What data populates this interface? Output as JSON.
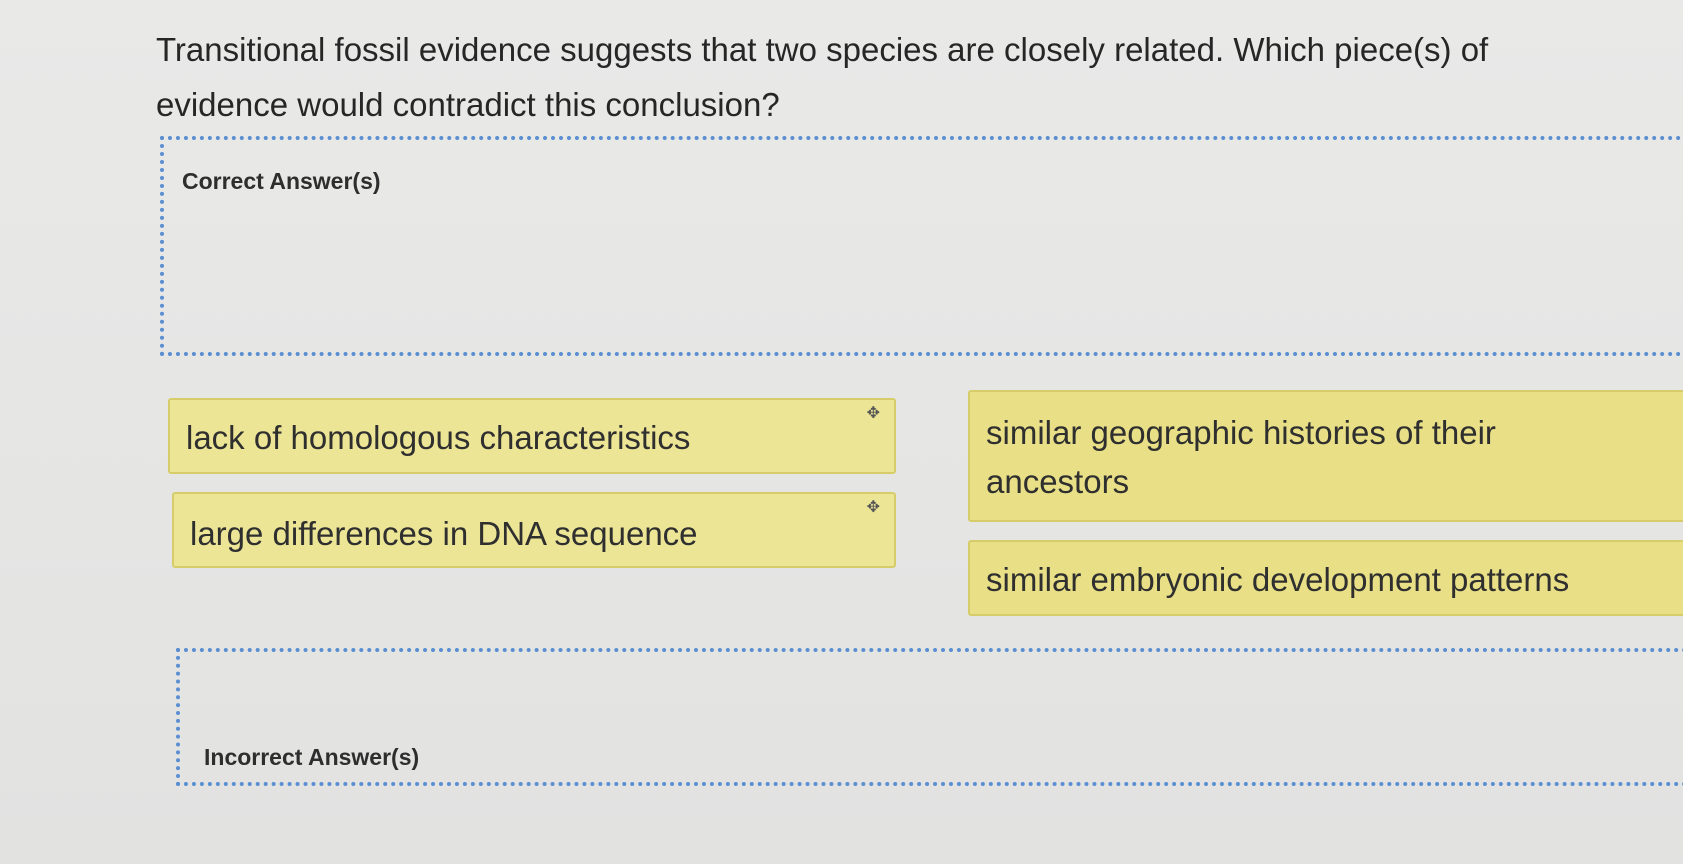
{
  "question": {
    "text": "Transitional fossil evidence suggests that two species are closely related. Which piece(s) of evidence would contradict this conclusion?"
  },
  "dropzones": {
    "correct_label": "Correct Answer(s)",
    "incorrect_label": "Incorrect Answer(s)"
  },
  "options": [
    {
      "label": "lack of homologous characteristics",
      "handle_icon": "move-icon"
    },
    {
      "label": "large differences in DNA sequence",
      "handle_icon": "move-icon"
    },
    {
      "label": "similar geographic histories of their ancestors"
    },
    {
      "label": "similar embryonic development patterns"
    }
  ],
  "colors": {
    "chip_fill": "#ece596",
    "chip_border": "#d6cd6a",
    "dropzone_border": "#5b8fd1",
    "background": "#e7e7e6"
  }
}
